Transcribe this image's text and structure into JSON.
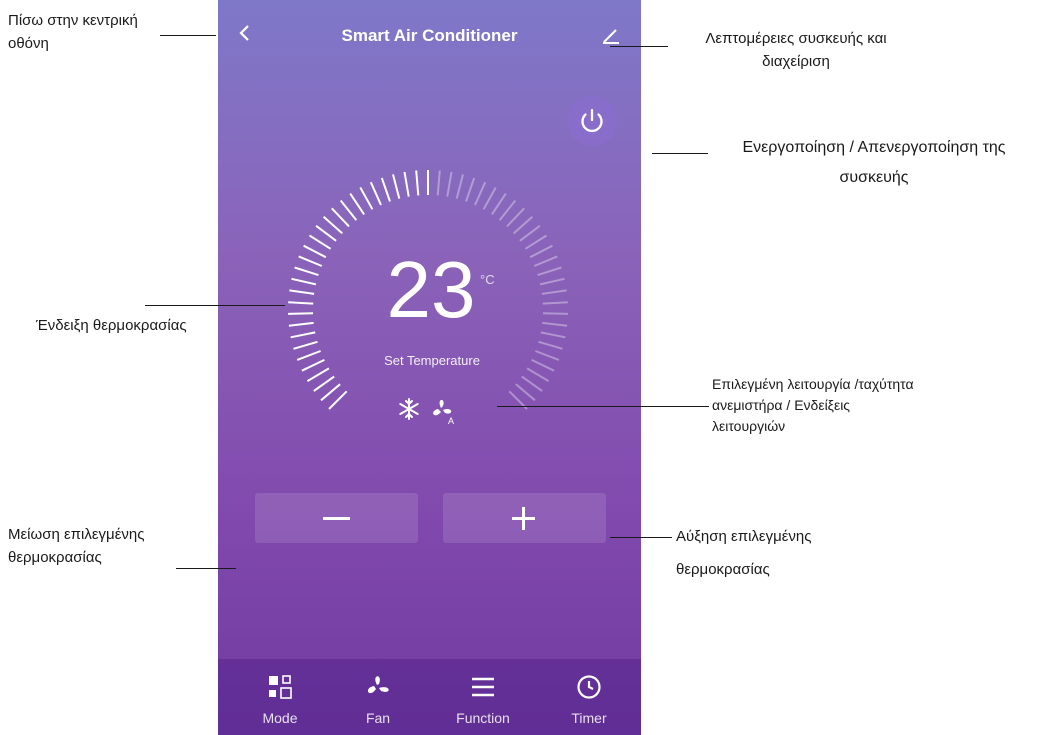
{
  "app": {
    "title": "Smart Air Conditioner",
    "temperature": "23",
    "unit": "°C",
    "temperature_label": "Set Temperature",
    "tabs": [
      {
        "label": "Mode",
        "icon": "mode-icon"
      },
      {
        "label": "Fan",
        "icon": "fan-icon"
      },
      {
        "label": "Function",
        "icon": "menu-icon"
      },
      {
        "label": "Timer",
        "icon": "clock-icon"
      }
    ],
    "colors": {
      "bg_top": "#7f78c9",
      "bg_bottom": "#6f3a9e",
      "text": "#ffffff"
    }
  },
  "annotations": {
    "back": "Πίσω στην κεντρική οθόνη",
    "device_details": "Λεπτομέρειες συσκευής και διαχείριση",
    "power": "Ενεργοποίηση / Απενεργοποίηση της συσκευής",
    "temperature_display": "Ένδειξη θερμοκρασίας",
    "mode_indicators": "Επιλεγμένη λειτουργία /ταχύτητα ανεμιστήρα / Ενδείξεις λειτουργιών",
    "decrease": "Μείωση επιλεγμένης θερμοκρασίας",
    "increase": "Αύξηση επιλεγμένης θερμοκρασίας"
  }
}
